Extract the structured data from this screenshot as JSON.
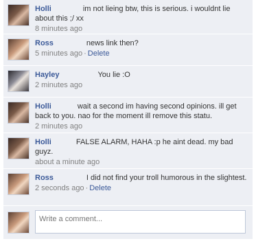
{
  "comments": [
    {
      "author": "Holli",
      "text": "im not lieing btw, this is serious. i wouldnt lie about this ;/ xx",
      "time": "8 minutes ago",
      "delete_label": ""
    },
    {
      "author": "Ross",
      "text": "news link then?",
      "time": "5 minutes ago",
      "delete_label": "Delete"
    },
    {
      "author": "Hayley",
      "text": "You lie :O",
      "time": "2 minutes ago",
      "delete_label": ""
    },
    {
      "author": "Holli",
      "text": "wait a second im having second opinions. ill get back to you. nao for the moment ill remove this statu.",
      "time": "2 minutes ago",
      "delete_label": ""
    },
    {
      "author": "Holli",
      "text": "FALSE ALARM, HAHA :p he aint dead. my bad guyz.",
      "time": "about a minute ago",
      "delete_label": ""
    },
    {
      "author": "Ross",
      "text": "I did not find your troll humorous in the slightest.",
      "time": "2 seconds ago",
      "delete_label": "Delete"
    }
  ],
  "compose": {
    "placeholder": "Write a comment..."
  },
  "separator": "·",
  "colors": {
    "background": "#edeff4",
    "link": "#3b5998",
    "meta": "#808080"
  }
}
